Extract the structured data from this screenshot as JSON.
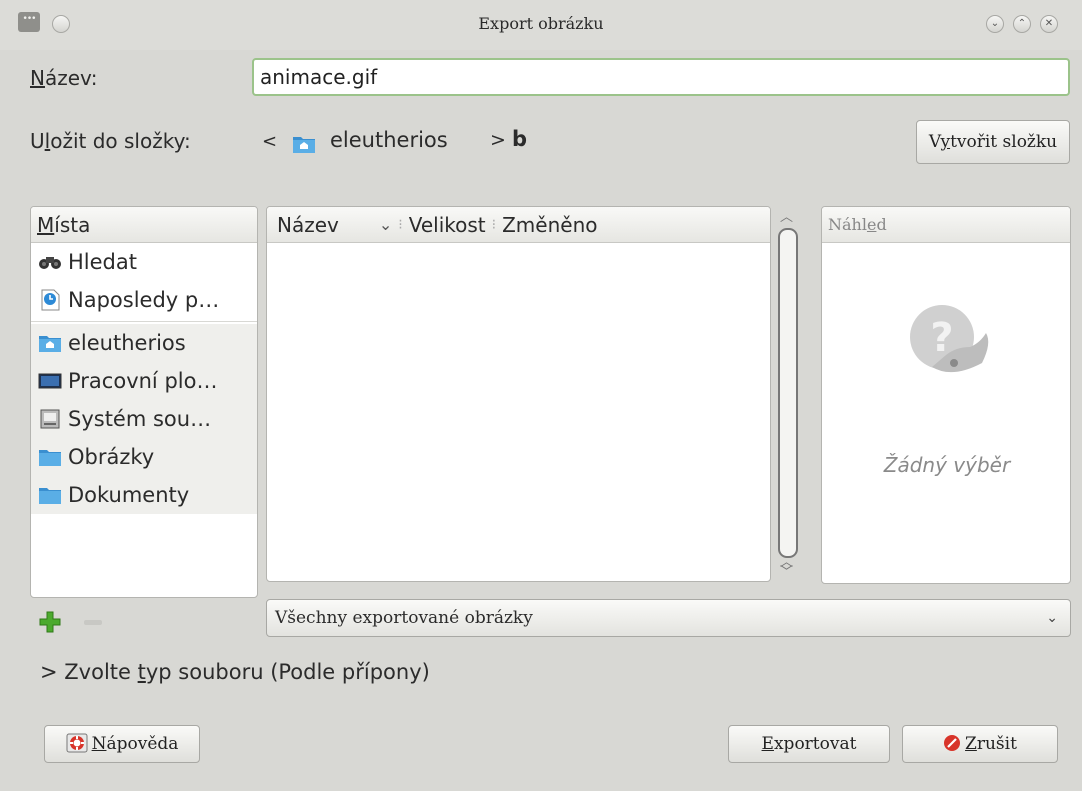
{
  "window": {
    "title": "Export obrázku",
    "controls": [
      "minimize",
      "maximize",
      "close"
    ]
  },
  "name_row": {
    "label_prefix": "N",
    "label_rest": "ázev:",
    "value": "animace.gif"
  },
  "folder_row": {
    "label_prefix": "U",
    "label_mnemonic": "l",
    "label_rest": "ožit do složky:",
    "back_glyph": "<",
    "crumbs": [
      "eleutherios",
      "b"
    ],
    "crumb_separator": ">",
    "create_folder_prefix": "V",
    "create_folder_mnemonic": "y",
    "create_folder_rest": "tvořit složku"
  },
  "places": {
    "header_mnemonic": "M",
    "header_rest": "ísta",
    "items": [
      {
        "label": "Hledat",
        "icon": "binoculars-icon"
      },
      {
        "label": "Naposledy p…",
        "icon": "recent-document-icon"
      },
      {
        "label": "eleutherios",
        "icon": "home-folder-icon"
      },
      {
        "label": "Pracovní plo…",
        "icon": "desktop-icon"
      },
      {
        "label": "Systém sou…",
        "icon": "filesystem-icon"
      },
      {
        "label": "Obrázky",
        "icon": "folder-icon"
      },
      {
        "label": "Dokumenty",
        "icon": "folder-icon"
      }
    ],
    "add_icon": "plus-icon",
    "remove_icon": "minus-icon"
  },
  "files": {
    "columns": [
      "Název",
      "Velikost",
      "Změněno"
    ],
    "sort_indicator": "⌄"
  },
  "preview": {
    "header_prefix": "Náhl",
    "header_mnemonic": "e",
    "header_rest": "d",
    "empty_text": "Žádný výběr"
  },
  "filter": {
    "selected": "Všechny exportované obrázky"
  },
  "file_type": {
    "expander_glyph": ">",
    "label_pre": "Zvolte ",
    "label_mnemonic": "t",
    "label_rest": "yp souboru (Podle přípony)"
  },
  "buttons": {
    "help_mnemonic": "N",
    "help_rest": "ápověda",
    "export_mnemonic": "E",
    "export_rest": "xportovat",
    "cancel_mnemonic": "Z",
    "cancel_rest": "rušit"
  },
  "colors": {
    "input_focus": "#9bc38a",
    "panel_bg": "#ffffff",
    "window_bg": "#d8d8d4"
  }
}
